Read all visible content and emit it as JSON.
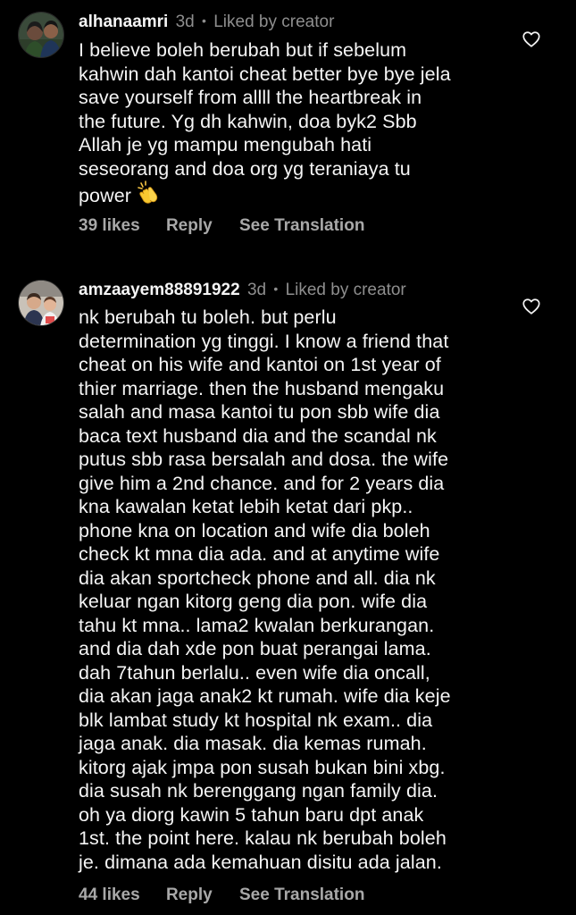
{
  "colors": {
    "background": "#000000",
    "text": "#f5f5f5",
    "muted": "#8e8e8e",
    "action": "#a8a8a8"
  },
  "comments": [
    {
      "username": "alhanaamri",
      "time": "3d",
      "separator": "•",
      "liked_by": "Liked by creator",
      "avatar_icon": "avatar-photo-couple",
      "lines": [
        "I believe boleh berubah but if sebelum",
        "kahwin dah kantoi cheat better bye bye jela",
        "save yourself from allll the heartbreak in",
        "the future. Yg dh kahwin, doa byk2 Sbb",
        "Allah je yg mampu mengubah hati",
        "seseorang and doa org yg teraniaya tu",
        "power"
      ],
      "emoji": "clapping-hands-emoji",
      "likes": "39 likes",
      "reply": "Reply",
      "translate": "See Translation",
      "like_icon": "heart-outline-icon"
    },
    {
      "username": "amzaayem88891922",
      "time": "3d",
      "separator": "•",
      "liked_by": "Liked by creator",
      "avatar_icon": "avatar-photo-children",
      "lines": [
        "nk berubah tu boleh. but perlu",
        "determination yg tinggi. I know a friend that",
        "cheat on his wife and kantoi on 1st year of",
        "thier marriage. then the husband mengaku",
        "salah and masa kantoi tu pon sbb wife dia",
        "baca text husband dia and the scandal nk",
        "putus sbb rasa bersalah and dosa. the wife",
        "give him a 2nd chance. and for 2 years dia",
        "kna kawalan ketat lebih ketat dari pkp..",
        "phone kna on location and wife dia boleh",
        "check kt mna dia ada. and at anytime wife",
        "dia akan sportcheck phone and all. dia nk",
        "keluar ngan kitorg geng dia pon. wife dia",
        "tahu kt mna.. lama2 kwalan berkurangan.",
        "and dia dah xde pon buat perangai lama.",
        "dah 7tahun berlalu.. even wife dia oncall,",
        "dia akan jaga anak2 kt rumah. wife dia keje",
        "blk lambat study kt hospital nk exam.. dia",
        "jaga anak. dia masak. dia kemas rumah.",
        "kitorg ajak jmpa pon susah bukan bini xbg.",
        "dia susah nk berenggang ngan family dia.",
        "oh ya diorg kawin 5 tahun baru dpt anak",
        "1st. the point here. kalau nk berubah boleh",
        "je. dimana ada kemahuan disitu ada jalan."
      ],
      "likes": "44 likes",
      "reply": "Reply",
      "translate": "See Translation",
      "like_icon": "heart-outline-icon"
    }
  ]
}
